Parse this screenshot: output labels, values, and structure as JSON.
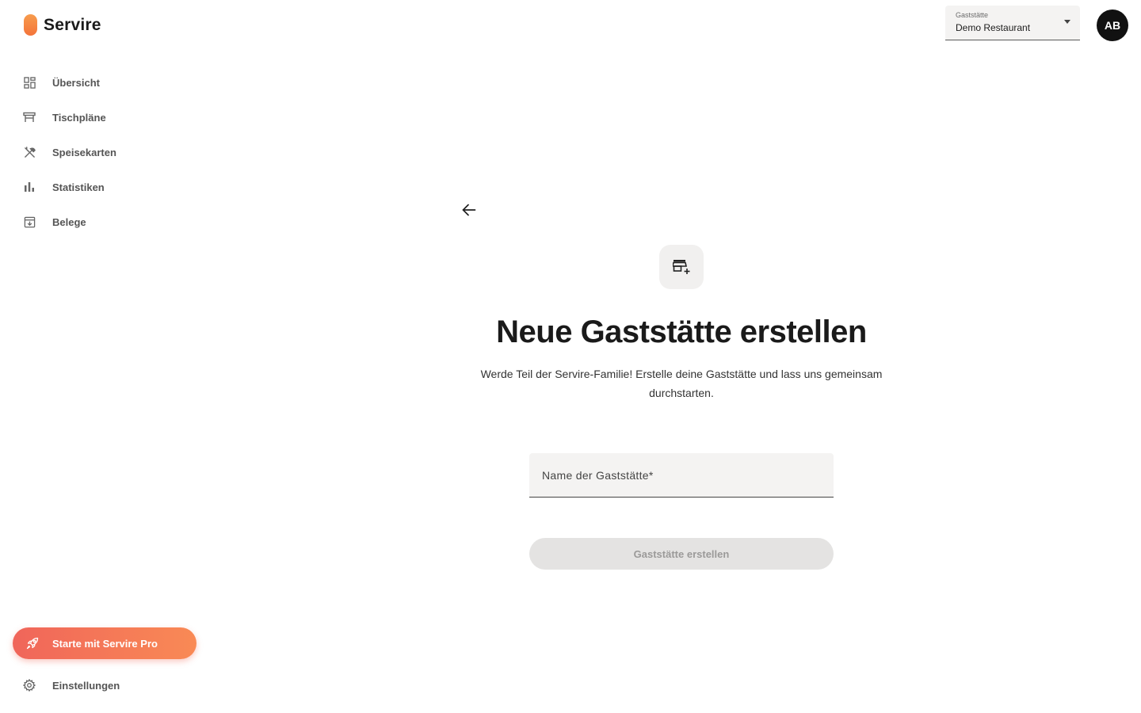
{
  "app": {
    "name": "Servire"
  },
  "sidebar": {
    "items": [
      {
        "label": "Übersicht",
        "icon": "dashboard-icon"
      },
      {
        "label": "Tischpläne",
        "icon": "table-icon"
      },
      {
        "label": "Speisekarten",
        "icon": "cutlery-icon"
      },
      {
        "label": "Statistiken",
        "icon": "bar-chart-icon"
      },
      {
        "label": "Belege",
        "icon": "receipt-archive-icon"
      }
    ],
    "pro_button_label": "Starte mit Servire Pro",
    "settings_label": "Einstellungen"
  },
  "header": {
    "restaurant_select": {
      "label": "Gaststätte",
      "value": "Demo Restaurant"
    },
    "avatar_initials": "AB"
  },
  "main": {
    "title": "Neue Gaststätte erstellen",
    "subtitle": "Werde Teil der Servire-Familie! Erstelle deine Gaststätte und lass uns gemeinsam durchstarten.",
    "name_field_placeholder": "Name der Gaststätte*",
    "create_button_label": "Gaststätte erstellen"
  },
  "colors": {
    "accent_start": "#f0655a",
    "accent_end": "#f98a55",
    "logo": "#f4743a",
    "avatar_bg": "#111111"
  }
}
